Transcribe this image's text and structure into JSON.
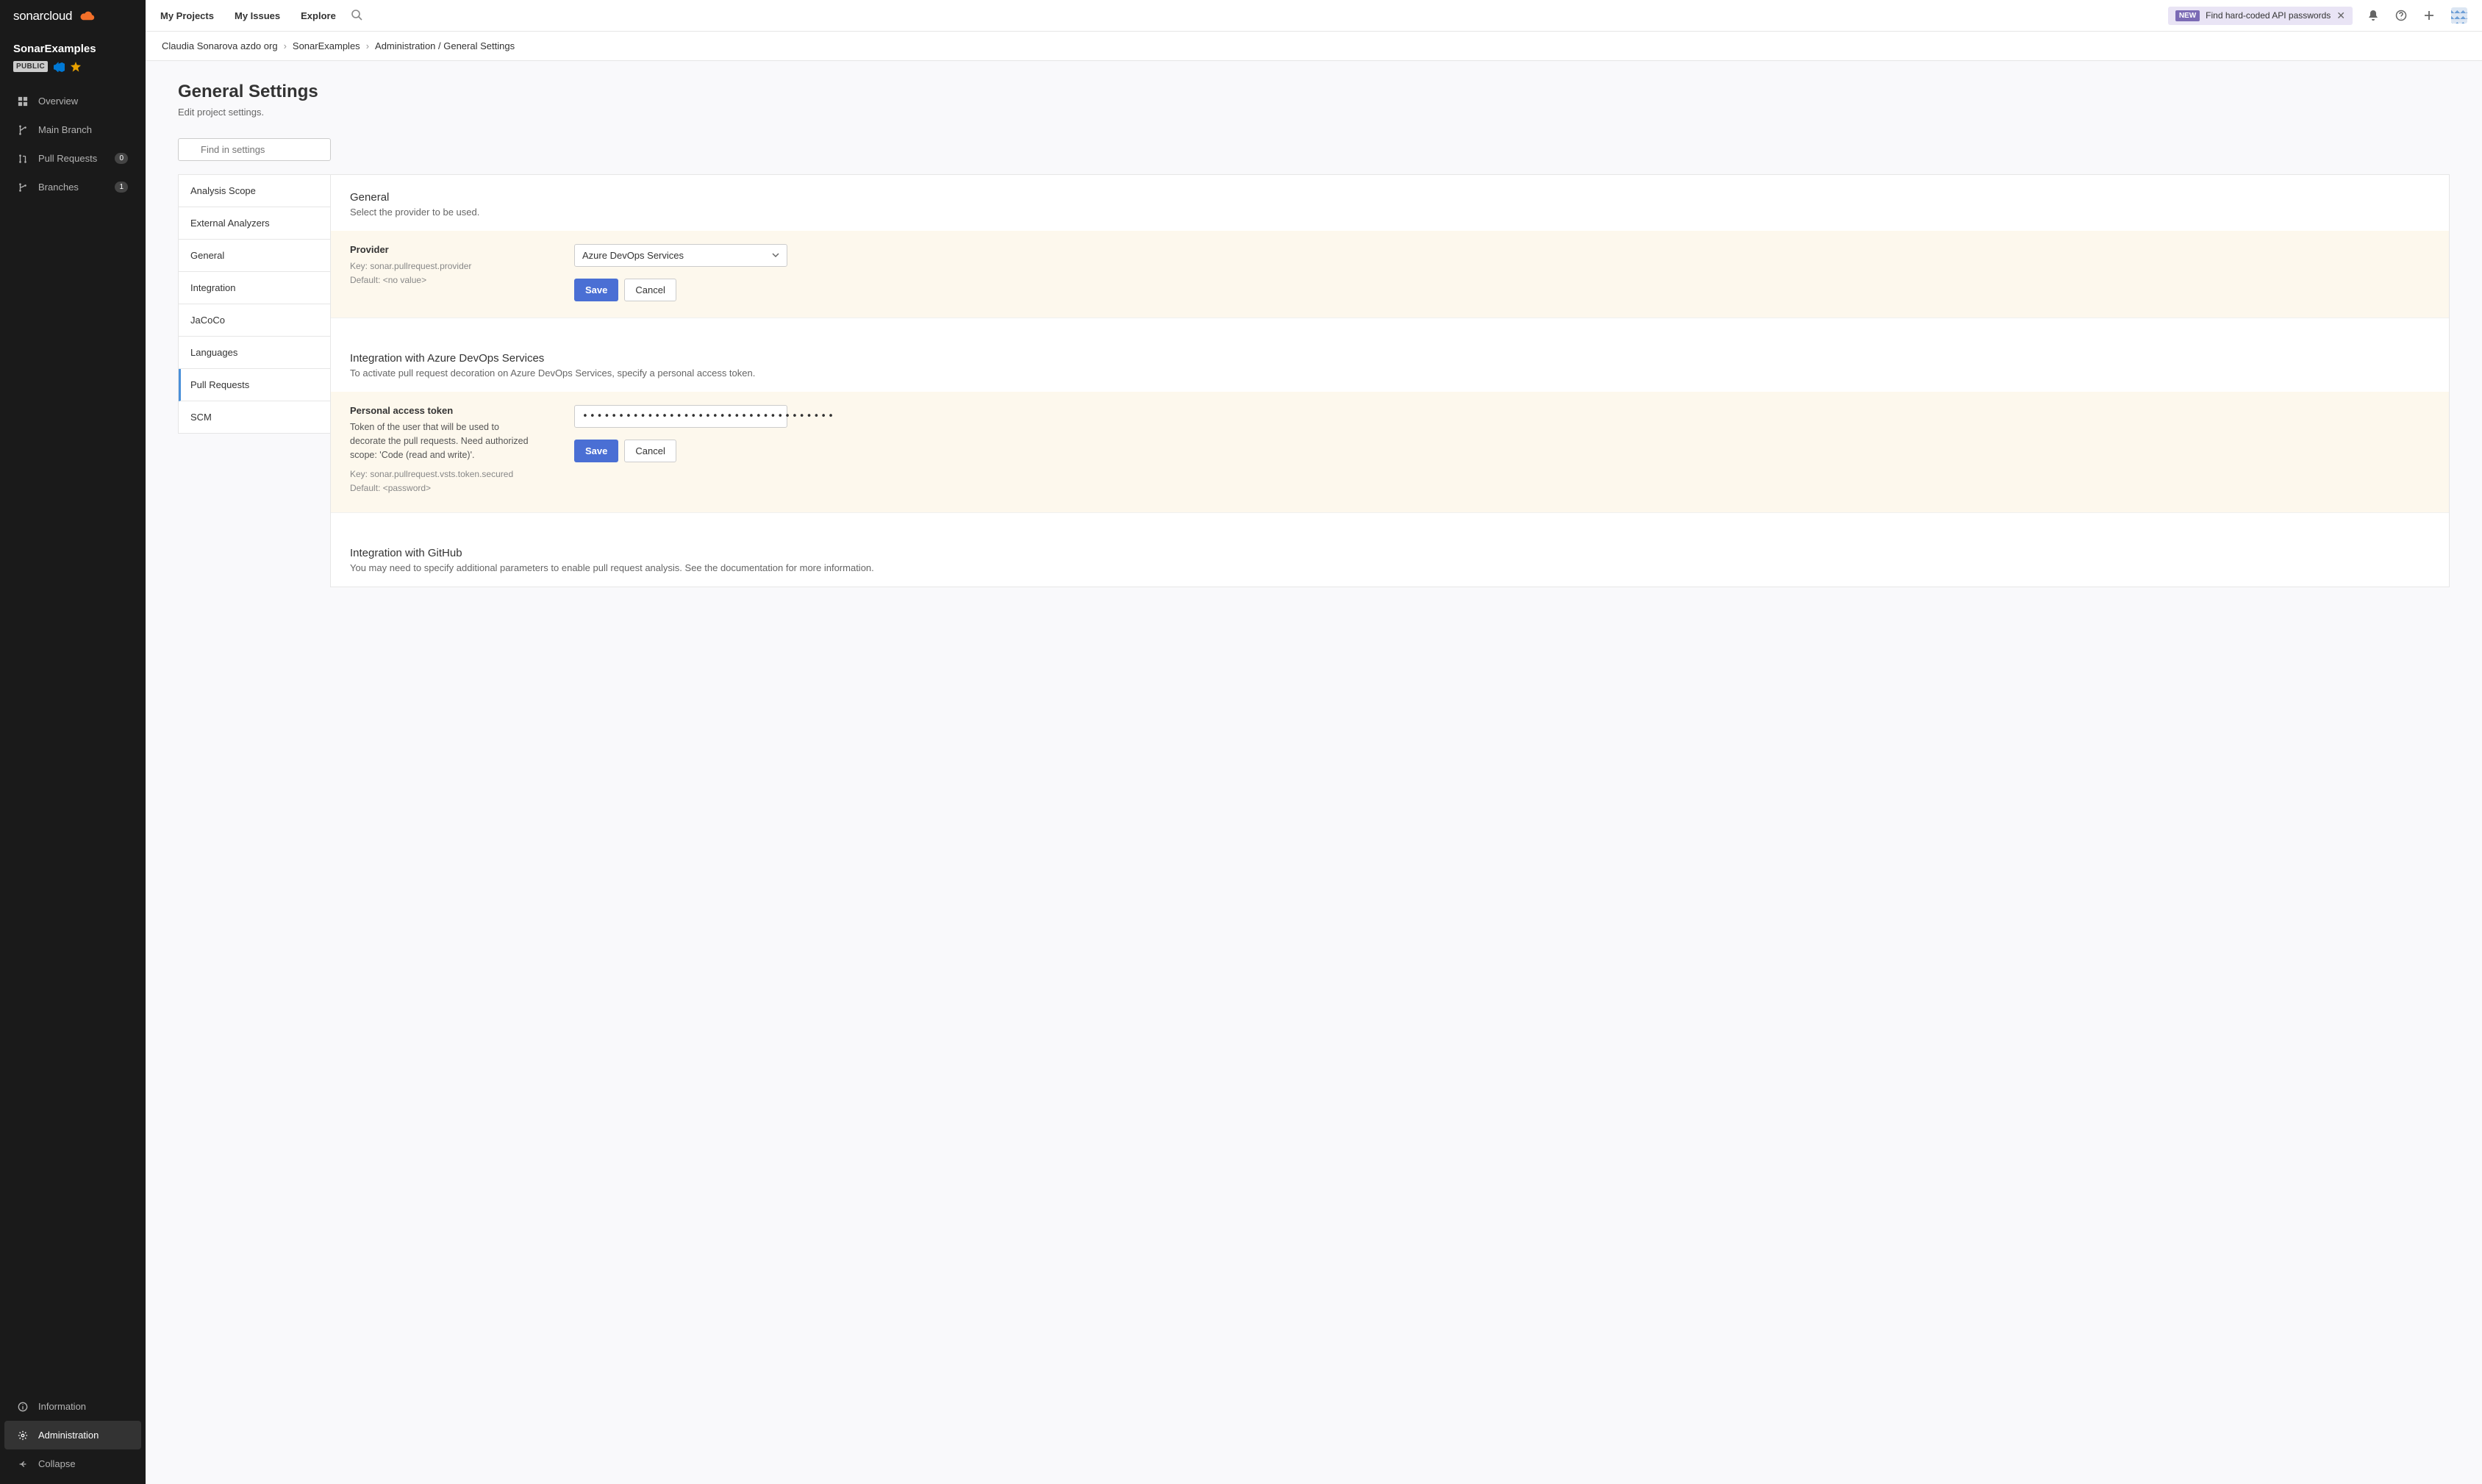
{
  "logo": {
    "text": "sonarcloud"
  },
  "project": {
    "name": "SonarExamples",
    "visibility": "PUBLIC"
  },
  "sidebar": {
    "overview": "Overview",
    "main_branch": "Main Branch",
    "pull_requests": "Pull Requests",
    "pr_count": "0",
    "branches": "Branches",
    "branches_count": "1",
    "information": "Information",
    "administration": "Administration",
    "collapse": "Collapse"
  },
  "topnav": {
    "my_projects": "My Projects",
    "my_issues": "My Issues",
    "explore": "Explore",
    "banner_pill": "NEW",
    "banner_text": "Find hard-coded API passwords"
  },
  "breadcrumb": {
    "org": "Claudia Sonarova azdo org",
    "project": "SonarExamples",
    "section": "Administration / General Settings"
  },
  "page": {
    "title": "General Settings",
    "subtitle": "Edit project settings.",
    "search_placeholder": "Find in settings"
  },
  "categories": {
    "analysis_scope": "Analysis Scope",
    "external_analyzers": "External Analyzers",
    "general": "General",
    "integration": "Integration",
    "jacoco": "JaCoCo",
    "languages": "Languages",
    "pull_requests": "Pull Requests",
    "scm": "SCM"
  },
  "sections": {
    "general": {
      "title": "General",
      "subtitle": "Select the provider to be used.",
      "provider_label": "Provider",
      "provider_key": "Key: sonar.pullrequest.provider",
      "provider_default": "Default: <no value>",
      "provider_value": "Azure DevOps Services",
      "save": "Save",
      "cancel": "Cancel"
    },
    "azure": {
      "title": "Integration with Azure DevOps Services",
      "subtitle": "To activate pull request decoration on Azure DevOps Services, specify a personal access token.",
      "token_label": "Personal access token",
      "token_help": "Token of the user that will be used to decorate the pull requests. Need authorized scope: 'Code (read and write)'.",
      "token_key": "Key: sonar.pullrequest.vsts.token.secured",
      "token_default": "Default: <password>",
      "token_value": "•••••••••••••••••••••••••••••••••••",
      "save": "Save",
      "cancel": "Cancel"
    },
    "github": {
      "title": "Integration with GitHub",
      "subtitle": "You may need to specify additional parameters to enable pull request analysis. See the documentation for more information."
    }
  }
}
